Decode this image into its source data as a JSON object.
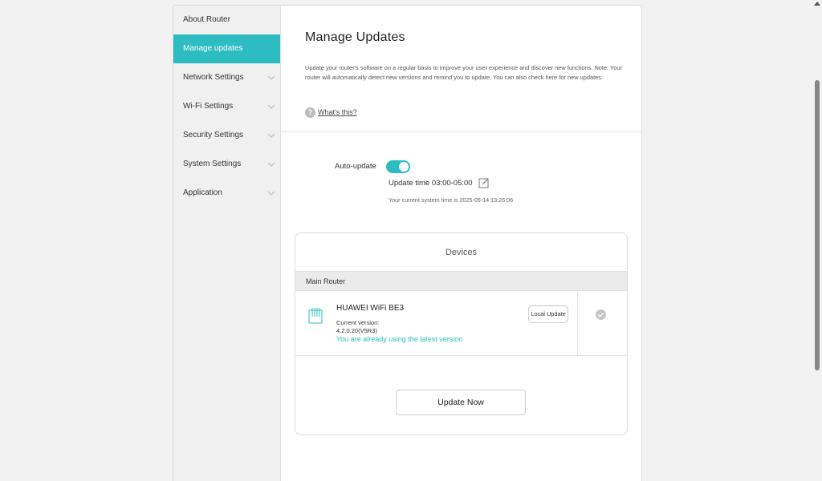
{
  "sidebar": {
    "items": [
      {
        "label": "About Router",
        "active": false
      },
      {
        "label": "Manage updates",
        "active": true
      },
      {
        "label": "Network Settings",
        "active": false
      },
      {
        "label": "Wi-Fi Settings",
        "active": false
      },
      {
        "label": "Security Settings",
        "active": false
      },
      {
        "label": "System Settings",
        "active": false
      },
      {
        "label": "Application",
        "active": false
      }
    ]
  },
  "main": {
    "title": "Manage Updates",
    "description": "Update your router's software on a regular basis to improve your user experience and discover new functions. Note: Your router will automatically detect new versions and remind you to update. You can also check here for new updates.",
    "whats_this": "What's this?",
    "auto_update": {
      "label": "Auto-update",
      "enabled": true,
      "update_time": "Update time 03:00-05:00",
      "system_time": "Your current system time is 2025-05-14 13:26:06"
    },
    "devices": {
      "title": "Devices",
      "group": "Main Router",
      "device": {
        "name": "HUAWEI WiFi BE3",
        "current_version_label": "Current version:",
        "current_version": "4.2.0.20(V5R3)",
        "status": "You are already using the latest version",
        "local_update_label": "Local Update"
      },
      "update_now_label": "Update Now"
    }
  },
  "colors": {
    "accent": "#2dbdc1",
    "sidebar_bg": "#f0f0f0",
    "page_bg": "#f2f2f2"
  }
}
